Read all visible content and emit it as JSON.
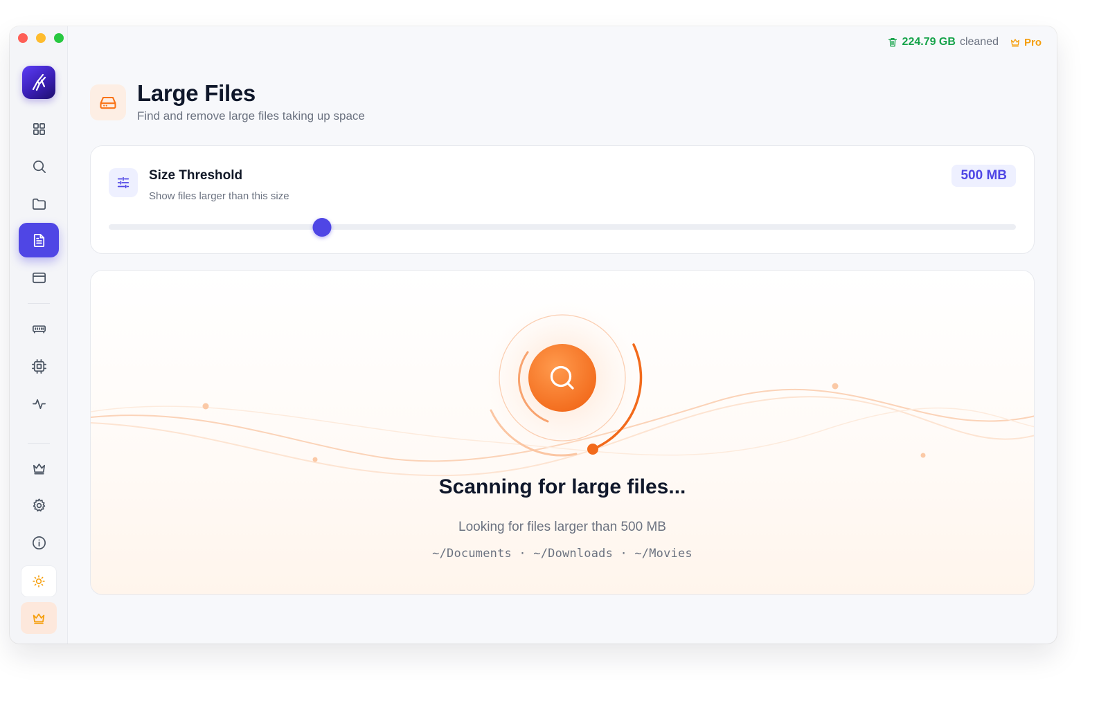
{
  "window": {
    "traffic_lights": [
      "close",
      "minimize",
      "zoom"
    ]
  },
  "sidebar": {
    "logo_icon": "app-logo-icon",
    "items": [
      {
        "id": "dashboard",
        "icon": "grid-icon",
        "active": false
      },
      {
        "id": "search",
        "icon": "search-icon",
        "active": false
      },
      {
        "id": "folders",
        "icon": "folder-icon",
        "active": false
      },
      {
        "id": "large-files",
        "icon": "document-icon",
        "active": true
      },
      {
        "id": "apps",
        "icon": "window-icon",
        "active": false
      },
      {
        "id": "memory",
        "icon": "memory-icon",
        "active": false
      },
      {
        "id": "cpu",
        "icon": "cpu-icon",
        "active": false
      },
      {
        "id": "activity",
        "icon": "activity-icon",
        "active": false
      },
      {
        "id": "premium",
        "icon": "crown-icon",
        "active": false
      },
      {
        "id": "settings",
        "icon": "gear-icon",
        "active": false
      },
      {
        "id": "about",
        "icon": "info-icon",
        "active": false
      }
    ],
    "theme_toggle_icon": "sun-icon",
    "pro_button_icon": "crown-icon"
  },
  "topbar": {
    "cleaned_value": "224.79 GB",
    "cleaned_label": "cleaned",
    "pro_label": "Pro"
  },
  "header": {
    "icon": "hard-drive-icon",
    "title": "Large Files",
    "subtitle": "Find and remove large files taking up space"
  },
  "threshold": {
    "icon": "sliders-icon",
    "title": "Size Threshold",
    "subtitle": "Show files larger than this size",
    "value_label": "500 MB",
    "slider_fraction": 0.235
  },
  "scan": {
    "icon": "search-icon",
    "title": "Scanning for large files...",
    "subtitle": "Looking for files larger than 500 MB",
    "paths": "~/Documents · ~/Downloads · ~/Movies"
  },
  "colors": {
    "accent": "#4f46e5",
    "scan_orange": "#f97316",
    "cleaned_green": "#16a34a",
    "pro_gold": "#f59e0b"
  }
}
